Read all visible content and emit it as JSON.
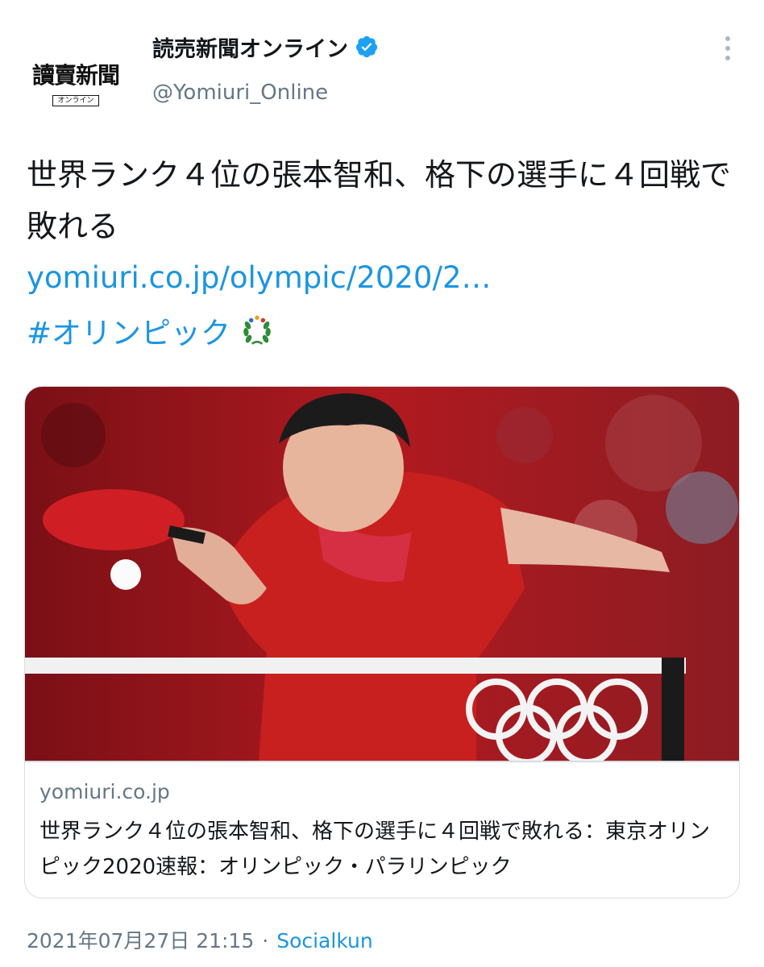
{
  "account": {
    "display_name": "読売新聞オンライン",
    "handle": "@Yomiuri_Online",
    "avatar_logo": "讀賣新聞",
    "avatar_sub": "オンライン",
    "verified_color": "#1da1f2"
  },
  "tweet": {
    "text": "世界ランク４位の張本智和、格下の選手に４回戦で敗れる",
    "link": "yomiuri.co.jp/olympic/2020/2…",
    "hashtag": "#オリンピック",
    "emoji": "olympic-laurel-icon"
  },
  "card": {
    "domain": "yomiuri.co.jp",
    "title": "世界ランク４位の張本智和、格下の選手に４回戦で敗れる：東京オリンピック2020速報：オリンピック・パラリンピック"
  },
  "meta": {
    "timestamp": "2021年07月27日 21:15",
    "separator": "·",
    "source": "Socialkun"
  },
  "colors": {
    "link": "#1b95e0",
    "secondary_text": "#657786",
    "border": "#d6dde3",
    "jersey_red": "#c8201e"
  }
}
